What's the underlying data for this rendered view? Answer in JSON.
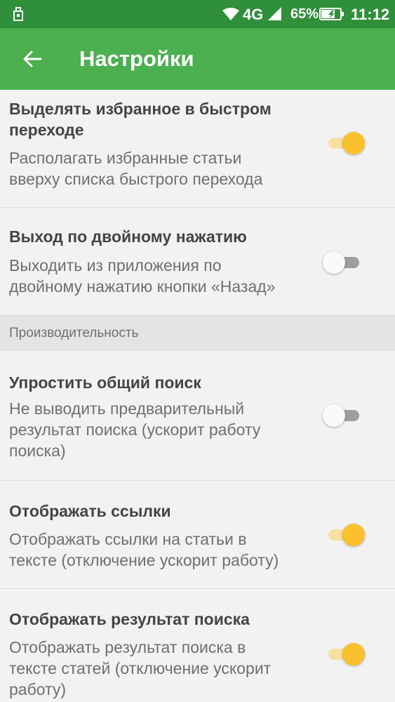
{
  "status_bar": {
    "network": "4G",
    "battery": "65%",
    "time": "11:12"
  },
  "app_bar": {
    "title": "Настройки",
    "back_icon": "arrow-left-icon"
  },
  "items": [
    {
      "title": "Выделять избранное в быстром переходе",
      "title_lines": [
        "Выделять избранное в быстром",
        "переходе"
      ],
      "subtitle_lines": [
        "Располагать избранные статьи",
        "вверху списка быстрого перехода"
      ],
      "enabled": true
    },
    {
      "title_lines": [
        "Выход по двойному нажатию"
      ],
      "subtitle_lines": [
        "Выходить из приложения по",
        "двойному нажатию кнопки «Назад»"
      ],
      "enabled": false
    },
    {
      "title_lines": [
        "Упростить общий поиск"
      ],
      "subtitle_lines": [
        "Не выводить предварительный",
        "результат поиска (ускорит работу",
        "поиска)"
      ],
      "enabled": false
    },
    {
      "title_lines": [
        "Отображать ссылки"
      ],
      "subtitle_lines": [
        "Отображать ссылки на статьи в",
        "тексте (отключение ускорит работу)"
      ],
      "enabled": true
    },
    {
      "title_lines": [
        "Отображать результат поиска"
      ],
      "subtitle_lines": [
        "Отображать результат поиска в",
        "тексте статей (отключение ускорит",
        "работу)"
      ],
      "enabled": true
    }
  ],
  "section_header": "Производительность",
  "colors": {
    "status_bar": "#2f8f3a",
    "app_bar": "#4caf50",
    "toggle_on": "#fbc02d",
    "toggle_off": "#fafafa"
  }
}
